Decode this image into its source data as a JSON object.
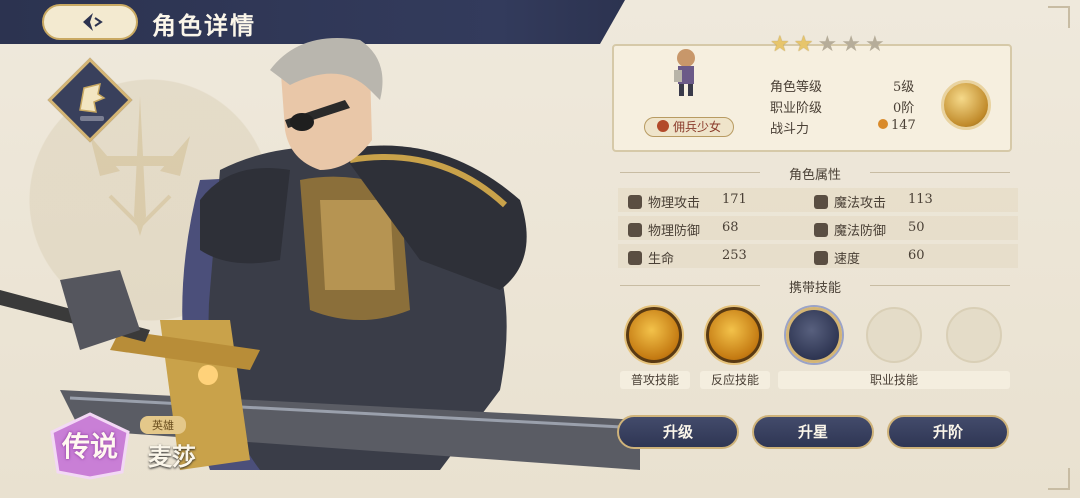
{
  "header": {
    "title": "角色详情"
  },
  "hero": {
    "rarity": "传说",
    "tag": "英雄",
    "name": "麦莎"
  },
  "profile": {
    "stars_total": 5,
    "stars_filled": 2,
    "job_tag": "佣兵少女",
    "rows": [
      {
        "label": "角色等级",
        "value": "5级"
      },
      {
        "label": "职业阶级",
        "value": "0阶"
      },
      {
        "label": "战斗力",
        "value": "147"
      }
    ]
  },
  "attributes": {
    "title": "角色属性",
    "items": [
      {
        "label": "物理攻击",
        "value": "171",
        "icon": "sword-icon"
      },
      {
        "label": "魔法攻击",
        "value": "113",
        "icon": "wand-icon"
      },
      {
        "label": "物理防御",
        "value": "68",
        "icon": "shield-icon"
      },
      {
        "label": "魔法防御",
        "value": "50",
        "icon": "hat-icon"
      },
      {
        "label": "生命",
        "value": "253",
        "icon": "heart-icon"
      },
      {
        "label": "速度",
        "value": "60",
        "icon": "wing-icon"
      }
    ]
  },
  "skills": {
    "title": "携带技能",
    "labels": {
      "normal": "普攻技能",
      "reaction": "反应技能",
      "class": "职业技能"
    }
  },
  "actions": {
    "level_up": "升级",
    "star_up": "升星",
    "rank_up": "升阶"
  }
}
